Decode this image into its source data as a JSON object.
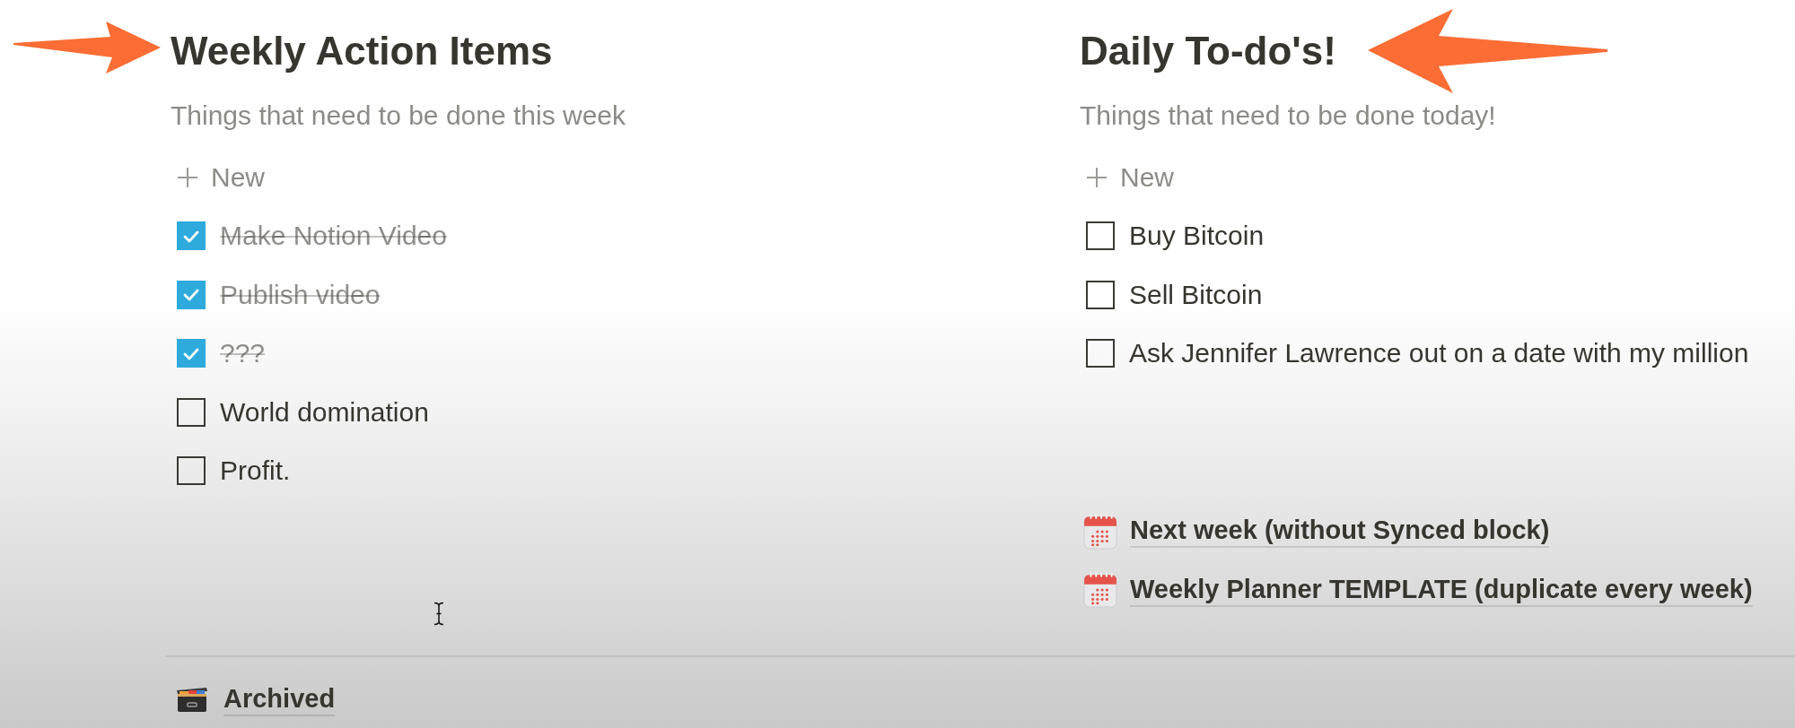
{
  "columns": [
    {
      "title": "Weekly Action Items",
      "description": "Things that need to be done this week",
      "new_label": "New",
      "todos": [
        {
          "text": "Make Notion Video",
          "checked": true
        },
        {
          "text": "Publish video",
          "checked": true
        },
        {
          "text": "???",
          "checked": true
        },
        {
          "text": "World domination",
          "checked": false
        },
        {
          "text": "Profit.",
          "checked": false
        }
      ]
    },
    {
      "title": "Daily To-do's!",
      "description": "Things that need to be done today!",
      "new_label": "New",
      "todos": [
        {
          "text": "Buy Bitcoin",
          "checked": false
        },
        {
          "text": "Sell Bitcoin",
          "checked": false
        },
        {
          "text": "Ask Jennifer Lawrence out on a date with my million",
          "checked": false
        }
      ],
      "page_links": [
        {
          "title": "Next week (without Synced block)"
        },
        {
          "title": "Weekly Planner TEMPLATE (duplicate every week)"
        }
      ]
    }
  ],
  "footer_link": {
    "title": "Archived"
  }
}
